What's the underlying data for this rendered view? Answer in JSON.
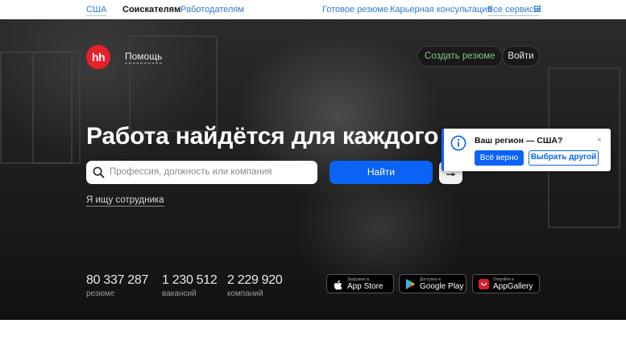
{
  "topbar": {
    "region": "США",
    "seekers": "Соискателям",
    "employers": "Работодателям",
    "ready_resume": "Готовое резюме",
    "career_consult": "Карьерная консультация",
    "all_services": "Все сервисы"
  },
  "header": {
    "logo_text": "hh",
    "help": "Помощь",
    "create_resume": "Создать резюме",
    "login": "Войти"
  },
  "hero": {
    "headline": "Работа найдётся для каждого",
    "search_placeholder": "Профессия, должность или компания",
    "find_button": "Найти",
    "employer_link": "Я ищу сотрудника"
  },
  "stats": [
    {
      "value": "80 337 287",
      "label": "резюме"
    },
    {
      "value": "1 230 512",
      "label": "вакансий"
    },
    {
      "value": "2 229 920",
      "label": "компаний"
    }
  ],
  "stores": [
    {
      "small": "Загрузите в",
      "name": "App Store",
      "icon": "apple-icon"
    },
    {
      "small": "Доступно в",
      "name": "Google Play",
      "icon": "google-play-icon"
    },
    {
      "small": "Откройте в",
      "name": "AppGallery",
      "icon": "appgallery-icon"
    }
  ],
  "region_popup": {
    "question": "Ваш регион — США?",
    "confirm": "Всё верно",
    "choose_other": "Выбрать другой",
    "close": "×"
  },
  "colors": {
    "brand_red": "#e8202c",
    "accent_blue": "#0a63f5",
    "link_blue": "#2b7bd0",
    "create_green": "#7fc77f"
  }
}
